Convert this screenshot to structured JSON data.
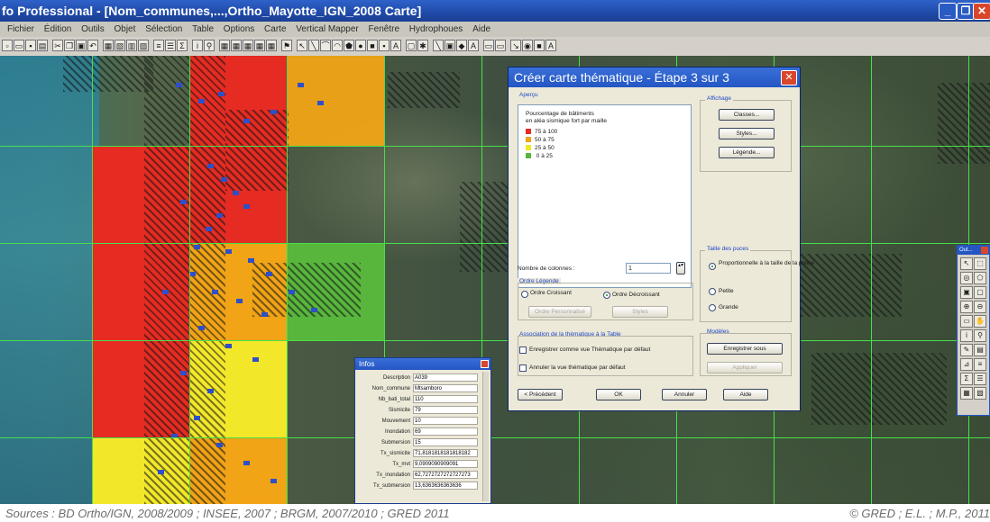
{
  "window": {
    "title": "fo Professional - [Nom_communes,...,Ortho_Mayotte_IGN_2008 Carte]",
    "minimize_glyph": "_",
    "restore_glyph": "❐",
    "close_glyph": "✕"
  },
  "menubar": {
    "items": [
      "Fichier",
      "Édition",
      "Outils",
      "Objet",
      "Sélection",
      "Table",
      "Options",
      "Carte",
      "Vertical Mapper",
      "Fenêtre",
      "Hydrophoues",
      "Aide"
    ]
  },
  "dialog": {
    "title": "Créer carte thématique - Étape 3 sur 3",
    "preview_label": "Aperçu",
    "legend_title_line1": "Pourcentage de bâtiments",
    "legend_title_line2": "en aléa sismique fort par maille",
    "legend": [
      {
        "label": "75 à 100",
        "color": "#e52b22"
      },
      {
        "label": "50 à  75",
        "color": "#f0a416"
      },
      {
        "label": "25 à  50",
        "color": "#f3e72a"
      },
      {
        "label": " 0 à  25",
        "color": "#58b63c"
      }
    ],
    "display_label": "Affichage",
    "classes_button": "Classes...",
    "styles_button": "Styles...",
    "legend_button": "Légende...",
    "point_size_label": "Taille des puces",
    "point_size_options": [
      "Proportionnelle à la taille de la police",
      "Petite",
      "Grande"
    ],
    "columns_label": "Nombre de colonnes :",
    "columns_value": "1",
    "order_label": "Ordre Légende",
    "order_ascending": "Ordre Croissant",
    "order_descending": "Ordre Décroissant",
    "order_custom_button": "Ordre Personnalisé",
    "order_styles_button": "Styles",
    "association_label": "Association de la thématique à la Table",
    "save_default_check": "Enregistrer comme vue Thématique par défaut",
    "cancel_default_check": "Annuler la vue thématique par défaut",
    "models_label": "Modèles",
    "save_as_button": "Enregistrer sous",
    "apply_button": "Appliquer",
    "prev_button": "< Précédent",
    "ok_button": "OK",
    "cancel_button": "Annuler",
    "help_button": "Aide"
  },
  "info": {
    "title": "Infos",
    "rows": [
      {
        "name": "Description",
        "value": "A039"
      },
      {
        "name": "Nom_commune",
        "value": "Mtsamboro"
      },
      {
        "name": "Nb_bati_total",
        "value": "110"
      },
      {
        "name": "Sismicite",
        "value": "79"
      },
      {
        "name": "Mouvement",
        "value": "10"
      },
      {
        "name": "Inondation",
        "value": "69"
      },
      {
        "name": "Submersion",
        "value": "15"
      },
      {
        "name": "Tx_sismicite",
        "value": "71,8181818181818182"
      },
      {
        "name": "Tx_mvt",
        "value": "9,0909090909091"
      },
      {
        "name": "Tx_inondation",
        "value": "62,7272727272727273"
      },
      {
        "name": "Tx_submersion",
        "value": "13,6363636363636"
      }
    ]
  },
  "palette": {
    "title": "Out..."
  },
  "caption": {
    "sources": "Sources : BD Ortho/IGN, 2008/2009 ; INSEE, 2007 ; BRGM, 2007/2010 ; GRED 2011",
    "copyright": "© GRED ; E.L. ; M.P., 2011"
  },
  "colors": {
    "class_75_100": "#e52b22",
    "class_50_75": "#f0a416",
    "class_25_50": "#f3e72a",
    "class_0_25": "#58b63c",
    "grid": "#46e04a",
    "buildings": "#2f4fc9"
  }
}
